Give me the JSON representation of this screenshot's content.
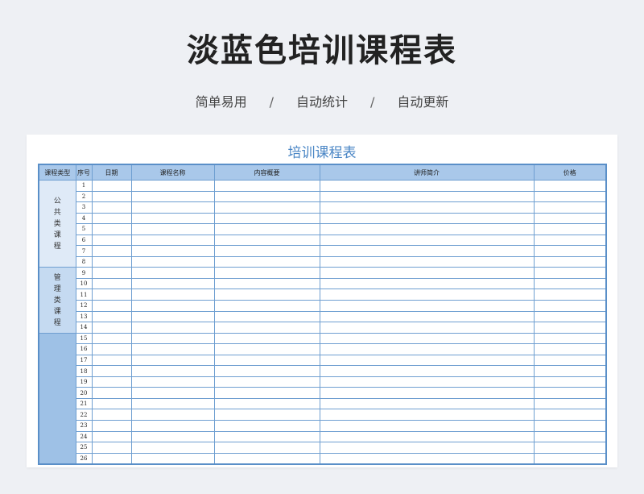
{
  "page": {
    "title": "淡蓝色培训课程表",
    "subtitle": [
      "简单易用",
      "自动统计",
      "自动更新"
    ],
    "separator": "/"
  },
  "sheet": {
    "title": "培训课程表",
    "headers": [
      "课程类型",
      "序号",
      "日期",
      "课程名称",
      "内容概要",
      "讲师简介",
      "价格"
    ],
    "categories": [
      {
        "label": "公共类课程",
        "rows": 8
      },
      {
        "label": "管理类课程",
        "rows": 6
      },
      {
        "label": "",
        "rows": 12
      }
    ],
    "row_numbers": [
      "1",
      "2",
      "3",
      "4",
      "5",
      "6",
      "7",
      "8",
      "9",
      "10",
      "11",
      "12",
      "13",
      "14",
      "15",
      "16",
      "17",
      "18",
      "19",
      "20",
      "21",
      "22",
      "23",
      "24",
      "25",
      "26"
    ]
  },
  "colors": {
    "accent": "#4a86c5",
    "header_bg": "#a9c8ea",
    "border": "#6f9fd1",
    "category_1": "#dfeaf7",
    "category_2": "#c5daf1",
    "category_3": "#9ec1e6"
  }
}
